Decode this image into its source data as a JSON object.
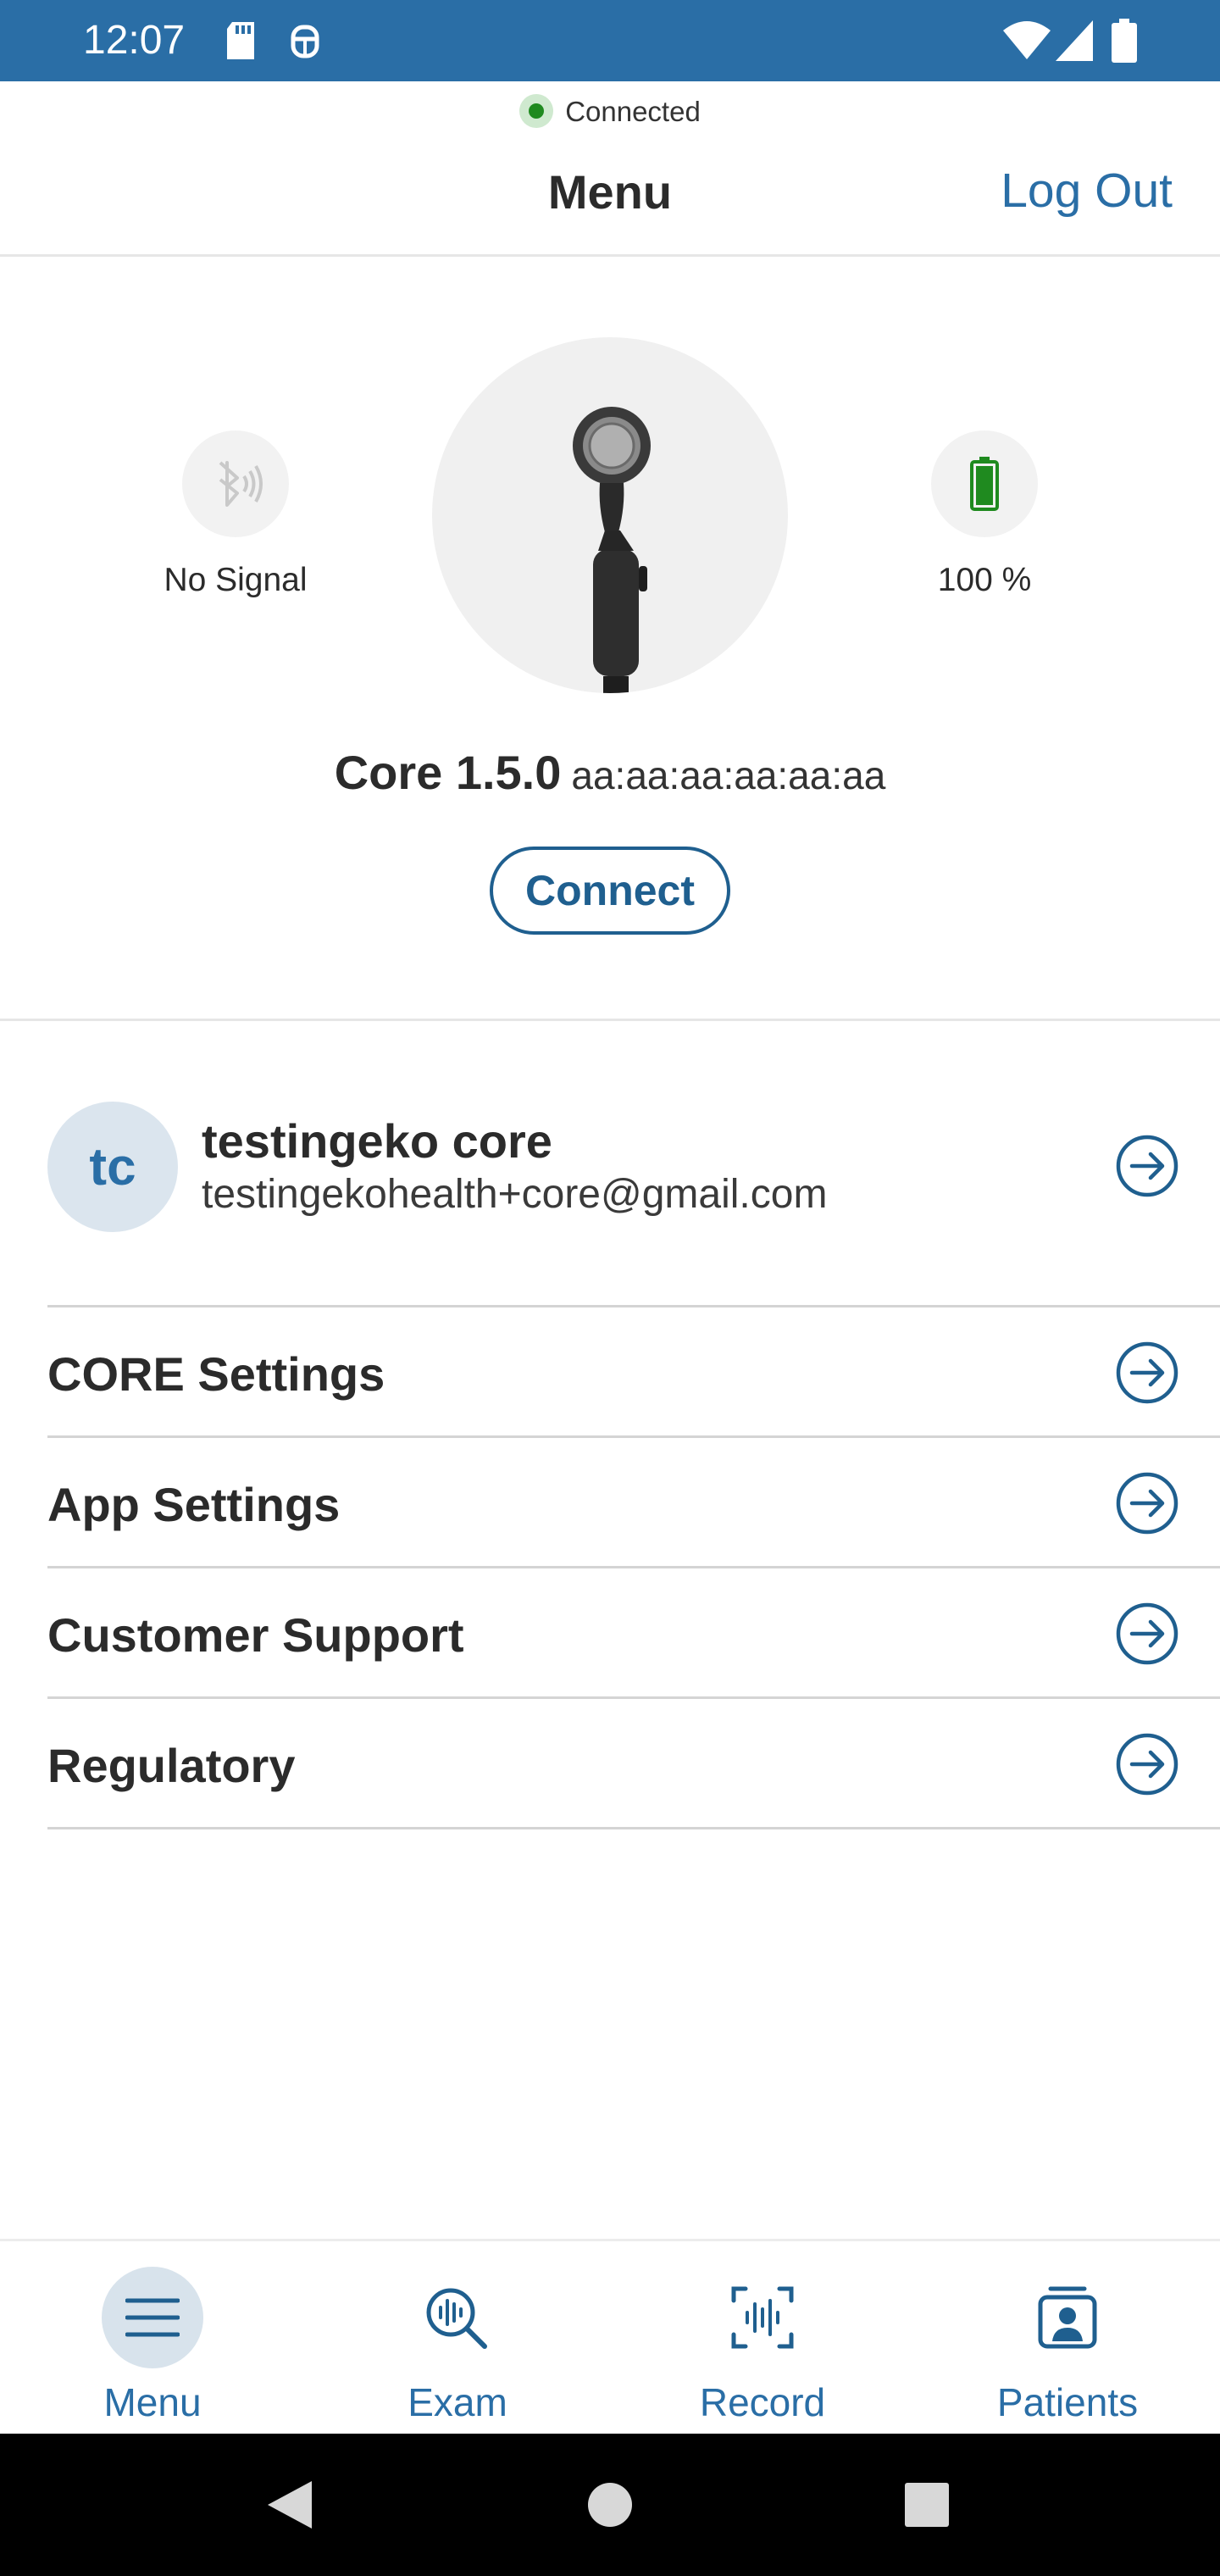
{
  "status_bar": {
    "time": "12:07"
  },
  "header": {
    "connection_status": "Connected",
    "title": "Menu",
    "logout_label": "Log Out"
  },
  "device": {
    "signal_label": "No Signal",
    "battery_label": "100 %",
    "model": "Core 1.5.0",
    "mac_address": "aa:aa:aa:aa:aa:aa",
    "connect_label": "Connect"
  },
  "profile": {
    "initials": "tc",
    "name": "testingeko core",
    "email": "testingekohealth+core@gmail.com"
  },
  "menu_items": [
    {
      "label": "CORE Settings"
    },
    {
      "label": "App Settings"
    },
    {
      "label": "Customer Support"
    },
    {
      "label": "Regulatory"
    }
  ],
  "bottom_nav": [
    {
      "label": "Menu",
      "icon": "menu-icon",
      "active": true
    },
    {
      "label": "Exam",
      "icon": "exam-icon",
      "active": false
    },
    {
      "label": "Record",
      "icon": "record-icon",
      "active": false
    },
    {
      "label": "Patients",
      "icon": "patients-icon",
      "active": false
    }
  ],
  "colors": {
    "status_bar": "#2a6ea6",
    "accent": "#2a6ea6",
    "connected_dot": "#1f8a1f",
    "battery_green": "#1f8a1f"
  }
}
